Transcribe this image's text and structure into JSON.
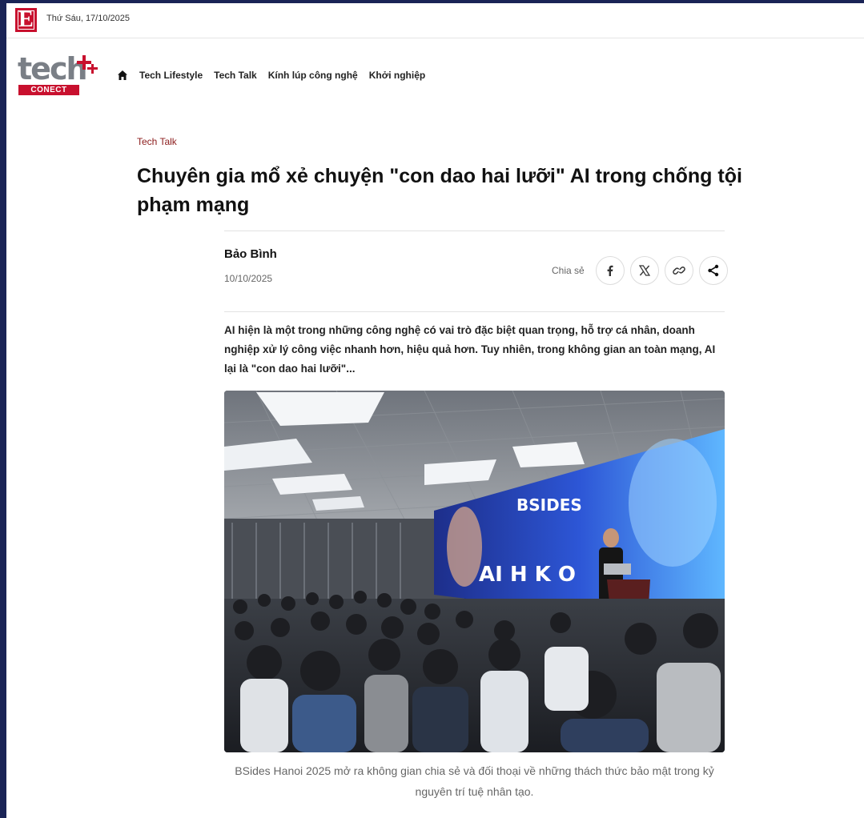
{
  "topbar": {
    "logo_letter": "E",
    "date": "Thứ Sáu, 17/10/2025"
  },
  "header": {
    "logo_word": "tech",
    "logo_sub": "CONECT",
    "nav": [
      {
        "label": "Tech Lifestyle"
      },
      {
        "label": "Tech Talk"
      },
      {
        "label": "Kính lúp công nghệ"
      },
      {
        "label": "Khởi nghiệp"
      }
    ]
  },
  "article": {
    "category": "Tech Talk",
    "title": "Chuyên gia mổ xẻ chuyện \"con dao hai lưỡi\" AI trong chống tội phạm mạng",
    "author": "Bảo Bình",
    "date": "10/10/2025",
    "share_label": "Chia sẻ",
    "share_icons": [
      "facebook-icon",
      "x-icon",
      "link-icon",
      "share-icon"
    ],
    "lead": "AI hiện là một trong những công nghệ có vai trò đặc biệt quan trọng, hỗ trợ cá nhân, doanh nghiệp xử lý công việc nhanh hơn, hiệu quả hơn. Tuy nhiên, trong không gian an toàn mạng, AI lại là \"con dao hai lưỡi\"...",
    "photo": {
      "screen_text_event": "BSIDES",
      "screen_text_main": "AI H K O"
    },
    "caption": "BSides Hanoi 2025 mở ra không gian chia sẻ và đối thoại về những thách thức bảo mật trong kỷ nguyên trí tuệ nhân tạo."
  },
  "colors": {
    "brand_red": "#c8102e",
    "category_red": "#8b1b1b",
    "outer_bg": "#1a2456"
  }
}
